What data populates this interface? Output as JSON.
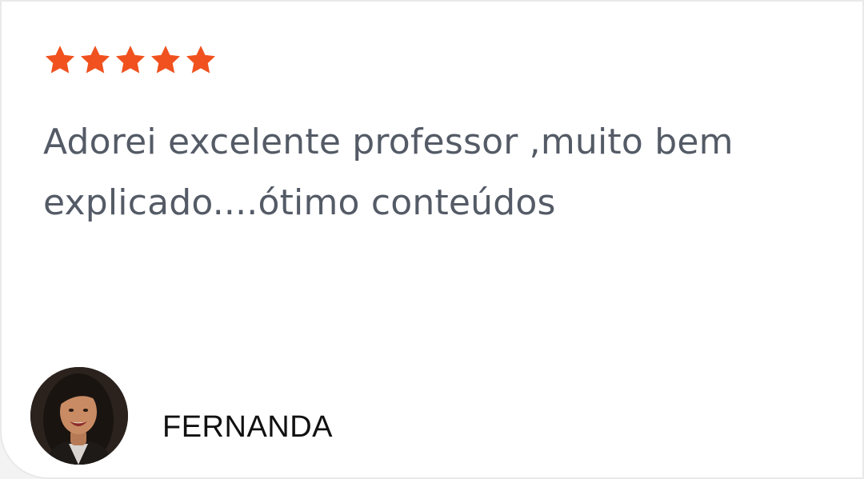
{
  "review": {
    "rating": 5,
    "rating_max": 5,
    "star_color": "#f0511f",
    "text": "Adorei excelente professor ,muito bem explicado....ótimo conteúdos"
  },
  "author": {
    "name": "FERNANDA",
    "avatar_icon": "user-photo"
  }
}
